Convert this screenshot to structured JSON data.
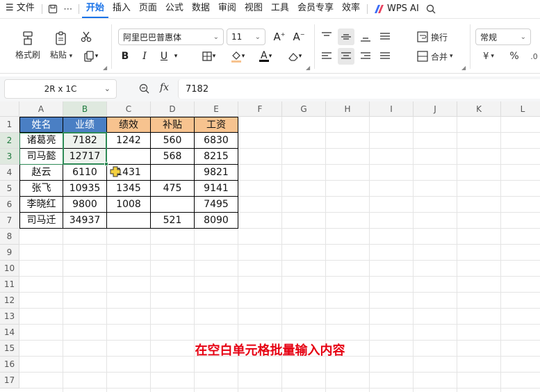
{
  "menubar": {
    "file": "文件",
    "tabs": [
      "开始",
      "插入",
      "页面",
      "公式",
      "数据",
      "审阅",
      "视图",
      "工具",
      "会员专享",
      "效率"
    ],
    "wps_ai": "WPS AI"
  },
  "ribbon": {
    "format_painter": "格式刷",
    "paste": "粘贴",
    "font_name": "阿里巴巴普惠体",
    "font_size": "11",
    "wrap": "换行",
    "merge": "合并",
    "number_format": "常规",
    "currency_symbol": "¥",
    "percent_symbol": "%",
    "bold": "B",
    "italic": "I",
    "underline": "U",
    "font_color_letter": "A"
  },
  "formula_bar": {
    "name_box": "2R x 1C",
    "fx": "fx",
    "value": "7182"
  },
  "sheet": {
    "columns": [
      "A",
      "B",
      "C",
      "D",
      "E",
      "F",
      "G",
      "H",
      "I",
      "J",
      "K",
      "L"
    ],
    "rows": [
      "1",
      "2",
      "3",
      "4",
      "5",
      "6",
      "7",
      "8",
      "9",
      "10",
      "11",
      "12",
      "13",
      "14",
      "15",
      "16",
      "17"
    ],
    "headers": [
      "姓名",
      "业绩",
      "绩效",
      "补贴",
      "工资"
    ],
    "data": [
      [
        "诸葛亮",
        "7182",
        "1242",
        "560",
        "6830"
      ],
      [
        "司马懿",
        "12717",
        "",
        "568",
        "8215"
      ],
      [
        "赵云",
        "6110",
        "1431",
        "",
        "9821"
      ],
      [
        "张飞",
        "10935",
        "1345",
        "475",
        "9141"
      ],
      [
        "李晓红",
        "9800",
        "1008",
        "",
        "7495"
      ],
      [
        "司马迁",
        "34937",
        "",
        "521",
        "8090"
      ]
    ]
  },
  "annotation": "在空白单元格批量输入内容",
  "colors": {
    "header_blue": "#4a7fc4",
    "header_orange": "#f7c38f",
    "selection_green": "#2e8b57",
    "active_tab": "#1a73e8",
    "annotation_red": "#e60012"
  }
}
